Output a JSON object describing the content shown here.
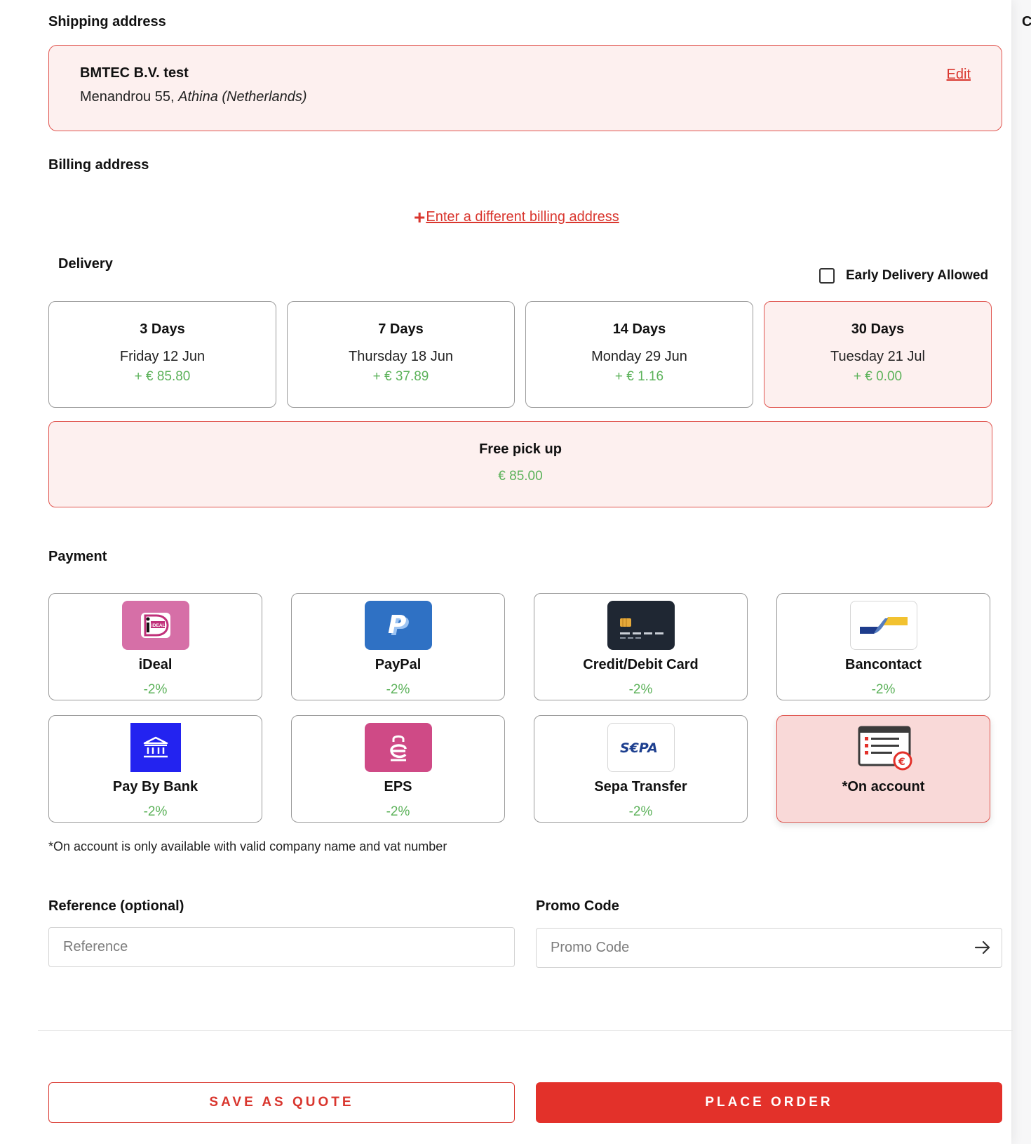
{
  "shipping": {
    "heading": "Shipping address",
    "name": "BMTEC B.V. test",
    "street": "Menandrou 55,",
    "city": "Athina",
    "country": "(Netherlands)",
    "edit_label": "Edit"
  },
  "billing": {
    "heading": "Billing address",
    "add_label": "Enter a different billing address",
    "plus": "+"
  },
  "delivery": {
    "heading": "Delivery",
    "early_label": "Early Delivery Allowed",
    "early_checked": false,
    "options": [
      {
        "days": "3 Days",
        "date": "Friday 12 Jun",
        "price": "+ € 85.80",
        "selected": false
      },
      {
        "days": "7 Days",
        "date": "Thursday 18 Jun",
        "price": "+ € 37.89",
        "selected": false
      },
      {
        "days": "14 Days",
        "date": "Monday 29 Jun",
        "price": "+ € 1.16",
        "selected": false
      },
      {
        "days": "30 Days",
        "date": "Tuesday 21 Jul",
        "price": "+ € 0.00",
        "selected": true
      }
    ],
    "pickup": {
      "label": "Free pick up",
      "price": "€ 85.00"
    }
  },
  "payment": {
    "heading": "Payment",
    "methods": [
      {
        "name": "iDeal",
        "discount": "-2%",
        "icon": "ideal-icon",
        "logo_text": "iDEAL"
      },
      {
        "name": "PayPal",
        "discount": "-2%",
        "icon": "paypal-icon",
        "logo_text": "P"
      },
      {
        "name": "Credit/Debit Card",
        "discount": "-2%",
        "icon": "credit-card-icon"
      },
      {
        "name": "Bancontact",
        "discount": "-2%",
        "icon": "bancontact-icon"
      },
      {
        "name": "Pay By Bank",
        "discount": "-2%",
        "icon": "bank-icon"
      },
      {
        "name": "EPS",
        "discount": "-2%",
        "icon": "eps-icon"
      },
      {
        "name": "Sepa Transfer",
        "discount": "-2%",
        "icon": "sepa-icon",
        "logo_text": "S€PA"
      },
      {
        "name": "*On account",
        "discount": "",
        "icon": "invoice-euro-icon",
        "selected": true
      }
    ],
    "note": "*On account is only available with valid company name and vat number"
  },
  "reference": {
    "label": "Reference (optional)",
    "placeholder": "Reference",
    "value": ""
  },
  "promo": {
    "label": "Promo Code",
    "placeholder": "Promo Code",
    "value": ""
  },
  "actions": {
    "save_quote": "SAVE AS QUOTE",
    "place_order": "PLACE ORDER"
  },
  "colors": {
    "accent": "#e3312a",
    "selected_bg": "#fdf0ef",
    "price_green": "#5cb25a"
  }
}
